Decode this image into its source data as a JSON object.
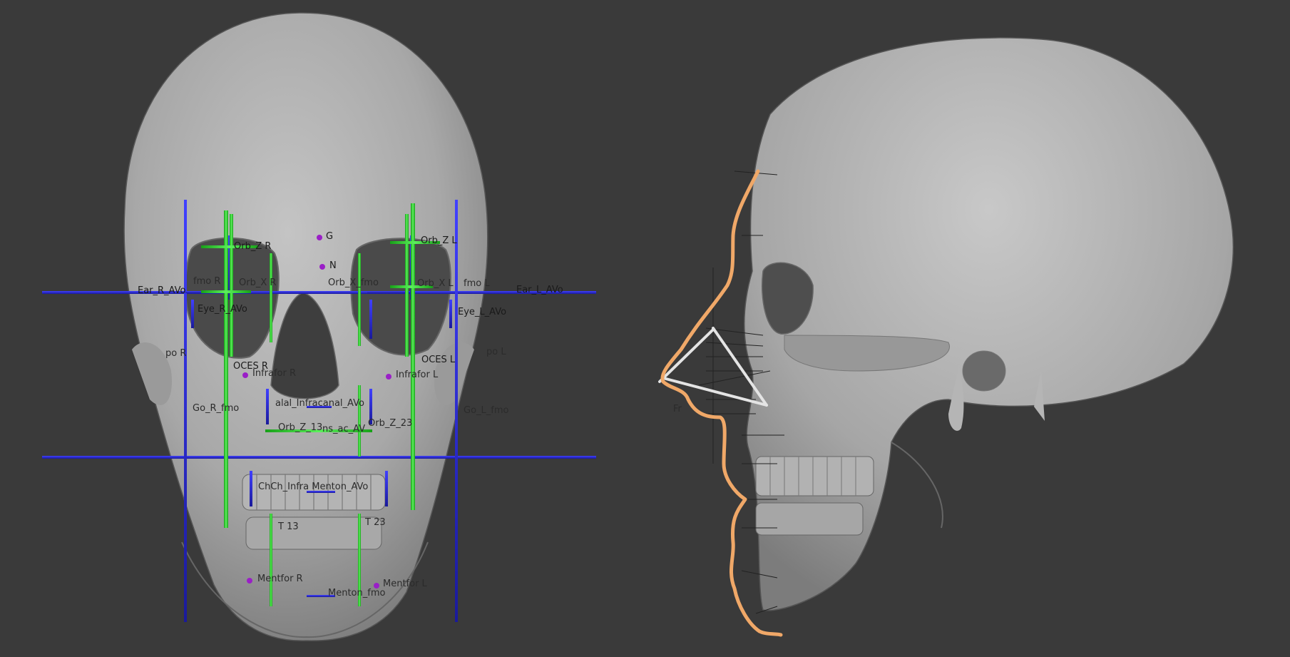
{
  "viewport": {
    "background": "#3a3a3a"
  },
  "colors": {
    "skull": "#a9a9a9",
    "guide_blue": "#2424c8",
    "guide_green": "#22c322",
    "landmark": "#9a1fc7",
    "profile": "#f0a868"
  },
  "labels": {
    "g": "G",
    "n": "N",
    "orb_z_r": "Orb_Z R",
    "orb_z_l": "Orb_Z L",
    "orb_x_r": "Orb_X R",
    "orb_x_l": "Orb_X L",
    "orb_x_fmo": "Orb_X_fmo",
    "fmo_r": "fmo R",
    "fmo_l": "fmo L",
    "ear_r": "Ear_R_AVo",
    "ear_l": "Ear_L_AVo",
    "eye_r": "Eye_R_AVo",
    "eye_l": "Eye_L_AVo",
    "po_r": "po R",
    "po_l": "po L",
    "oces_r": "OCES R",
    "oces_l": "OCES L",
    "infrafor_r": "Infrafor R",
    "infrafor_l": "Infrafor L",
    "go_r": "Go_R_fmo",
    "go_l": "Go_L_fmo",
    "alal": "alal_Infracanal_AVo",
    "orb_z13": "Orb_Z_13",
    "ns_ac": "ns_ac_AV",
    "orb_z23": "Orb_Z_23",
    "chch": "ChCh_Infra Menton_AVo",
    "t13": "T 13",
    "t23": "T 23",
    "mentfor_r": "Mentfor R",
    "mentfor_l": "Mentfor L",
    "menton": "Menton_fmo",
    "side_tag": "Fr"
  }
}
